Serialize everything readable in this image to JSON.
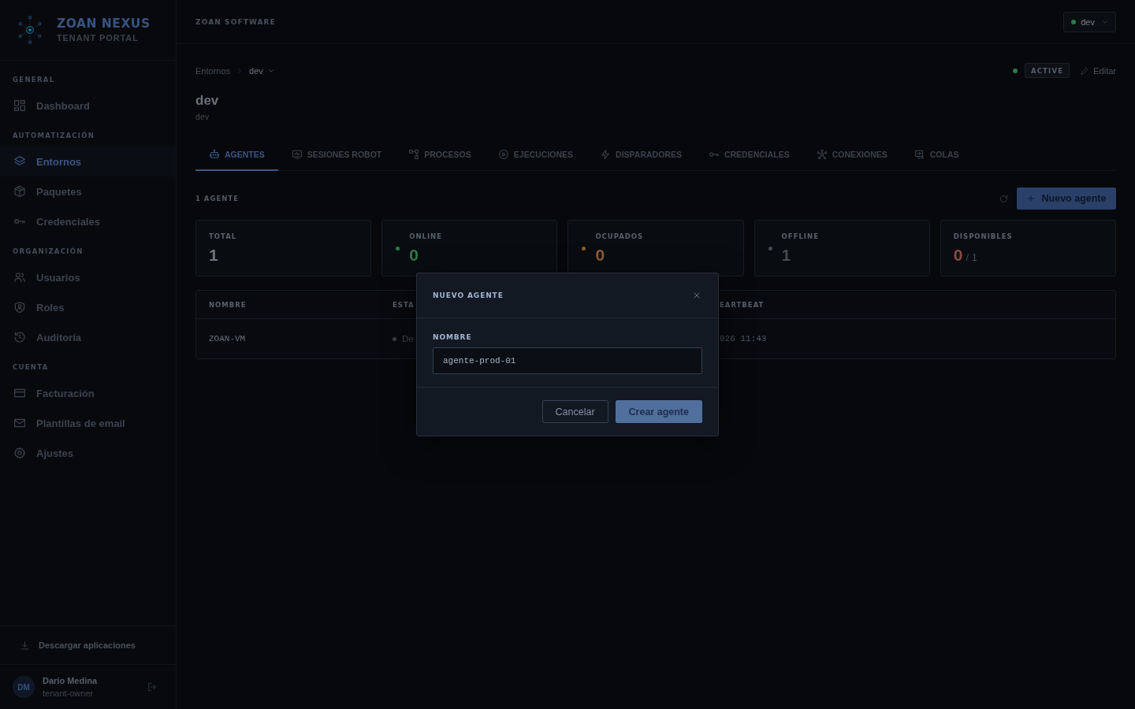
{
  "sidebar": {
    "brand": {
      "name": "ZOAN NEXUS",
      "subtitle": "TENANT PORTAL"
    },
    "sections": [
      {
        "heading": "GENERAL",
        "items": [
          {
            "label": "Dashboard",
            "selected": false
          }
        ]
      },
      {
        "heading": "AUTOMATIZACIÓN",
        "items": [
          {
            "label": "Entornos",
            "selected": true
          },
          {
            "label": "Paquetes",
            "selected": false
          },
          {
            "label": "Credenciales",
            "selected": false
          }
        ]
      },
      {
        "heading": "ORGANIZACIÓN",
        "items": [
          {
            "label": "Usuarios",
            "selected": false
          },
          {
            "label": "Roles",
            "selected": false
          },
          {
            "label": "Auditoría",
            "selected": false
          }
        ]
      },
      {
        "heading": "CUENTA",
        "items": [
          {
            "label": "Facturación",
            "selected": false
          },
          {
            "label": "Plantillas de email",
            "selected": false
          },
          {
            "label": "Ajustes",
            "selected": false
          }
        ]
      }
    ],
    "download_link": "Descargar aplicaciones",
    "user": {
      "initials": "DM",
      "name": "Dario Medina",
      "role": "tenant-owner"
    }
  },
  "header": {
    "organization": "ZOAN SOFTWARE",
    "environment_selector": {
      "value": "dev",
      "active": true
    }
  },
  "breadcrumb": [
    {
      "label": "Entornos",
      "kind": "link"
    },
    {
      "label": "dev",
      "kind": "dropdown"
    }
  ],
  "page": {
    "title": "dev",
    "subtitle": "dev",
    "status": "ACTIVE",
    "active": true,
    "edit_label": "Editar"
  },
  "tabs": [
    {
      "label": "AGENTES",
      "selected": true
    },
    {
      "label": "SESIONES ROBOT",
      "selected": false
    },
    {
      "label": "PROCESOS",
      "selected": false
    },
    {
      "label": "EJECUCIONES",
      "selected": false
    },
    {
      "label": "DISPARADORES",
      "selected": false
    },
    {
      "label": "CREDENCIALES",
      "selected": false
    },
    {
      "label": "CONEXIONES",
      "selected": false
    },
    {
      "label": "COLAS",
      "selected": false
    }
  ],
  "agents": {
    "count_label": "1 AGENTE",
    "new_button": "Nuevo agente",
    "stats": [
      {
        "kind": "count",
        "label": "TOTAL",
        "value": "1",
        "color": "#6b7380"
      },
      {
        "kind": "status",
        "label": "ONLINE",
        "value": "0",
        "color": "#2f7a47"
      },
      {
        "kind": "status",
        "label": "OCUPADOS",
        "value": "0",
        "color": "#8f5d2c"
      },
      {
        "kind": "status",
        "label": "OFFLINE",
        "value": "1",
        "color": "#454b55"
      },
      {
        "kind": "ratio",
        "label": "DISPONIBLES",
        "value": "0",
        "suffix": "/ 1",
        "color": "#8b4a3c"
      }
    ],
    "table": {
      "columns": [
        "NOMBRE",
        "ESTA",
        "EARTBEAT"
      ],
      "rows": [
        {
          "name": "ZOAN-VM",
          "status": {
            "label": "De",
            "color": "#3a4048"
          },
          "heartbeat": "026 11:43"
        }
      ]
    }
  },
  "modal": {
    "title": "NUEVO AGENTE",
    "field_label": "NOMBRE",
    "value": "agente-prod-01",
    "buttons": [
      {
        "label": "Cancelar",
        "kind": "secondary"
      },
      {
        "label": "Crear agente",
        "kind": "primary"
      }
    ]
  }
}
